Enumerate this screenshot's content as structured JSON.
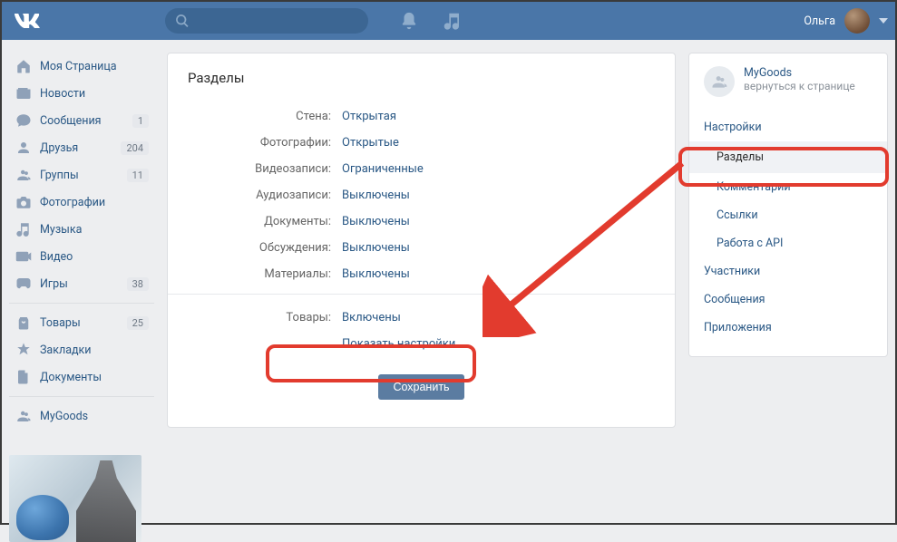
{
  "header": {
    "username": "Ольга"
  },
  "leftnav": {
    "items": [
      {
        "icon": "home",
        "label": "Моя Страница",
        "count": null
      },
      {
        "icon": "news",
        "label": "Новости",
        "count": null
      },
      {
        "icon": "msg",
        "label": "Сообщения",
        "count": "1"
      },
      {
        "icon": "friends",
        "label": "Друзья",
        "count": "204"
      },
      {
        "icon": "groups",
        "label": "Группы",
        "count": "11"
      },
      {
        "icon": "photo",
        "label": "Фотографии",
        "count": null
      },
      {
        "icon": "music",
        "label": "Музыка",
        "count": null
      },
      {
        "icon": "video",
        "label": "Видео",
        "count": null
      },
      {
        "icon": "games",
        "label": "Игры",
        "count": "38"
      }
    ],
    "items2": [
      {
        "icon": "goods",
        "label": "Товары",
        "count": "25"
      },
      {
        "icon": "bookmark",
        "label": "Закладки",
        "count": null
      },
      {
        "icon": "docs",
        "label": "Документы",
        "count": null
      }
    ],
    "items3": [
      {
        "icon": "groups",
        "label": "MyGoods",
        "count": null
      }
    ]
  },
  "main": {
    "title": "Разделы",
    "rows": [
      {
        "label": "Стена:",
        "value": "Открытая"
      },
      {
        "label": "Фотографии:",
        "value": "Открытые"
      },
      {
        "label": "Видеозаписи:",
        "value": "Ограниченные"
      },
      {
        "label": "Аудиозаписи:",
        "value": "Выключены"
      },
      {
        "label": "Документы:",
        "value": "Выключены"
      },
      {
        "label": "Обсуждения:",
        "value": "Выключены"
      },
      {
        "label": "Материалы:",
        "value": "Выключены"
      }
    ],
    "goods_label": "Товары:",
    "goods_value": "Включены",
    "show_settings": "Показать настройки",
    "save": "Сохранить"
  },
  "right": {
    "group_name": "MyGoods",
    "back": "вернуться к странице",
    "items_top": [
      "Настройки"
    ],
    "active": "Разделы",
    "items_sub": [
      "Комментарии",
      "Ссылки",
      "Работа с API"
    ],
    "items_bottom": [
      "Участники",
      "Сообщения",
      "Приложения"
    ]
  },
  "colors": {
    "accent": "#4a76a8",
    "link": "#2a5885",
    "highlight": "#e23b2e"
  }
}
